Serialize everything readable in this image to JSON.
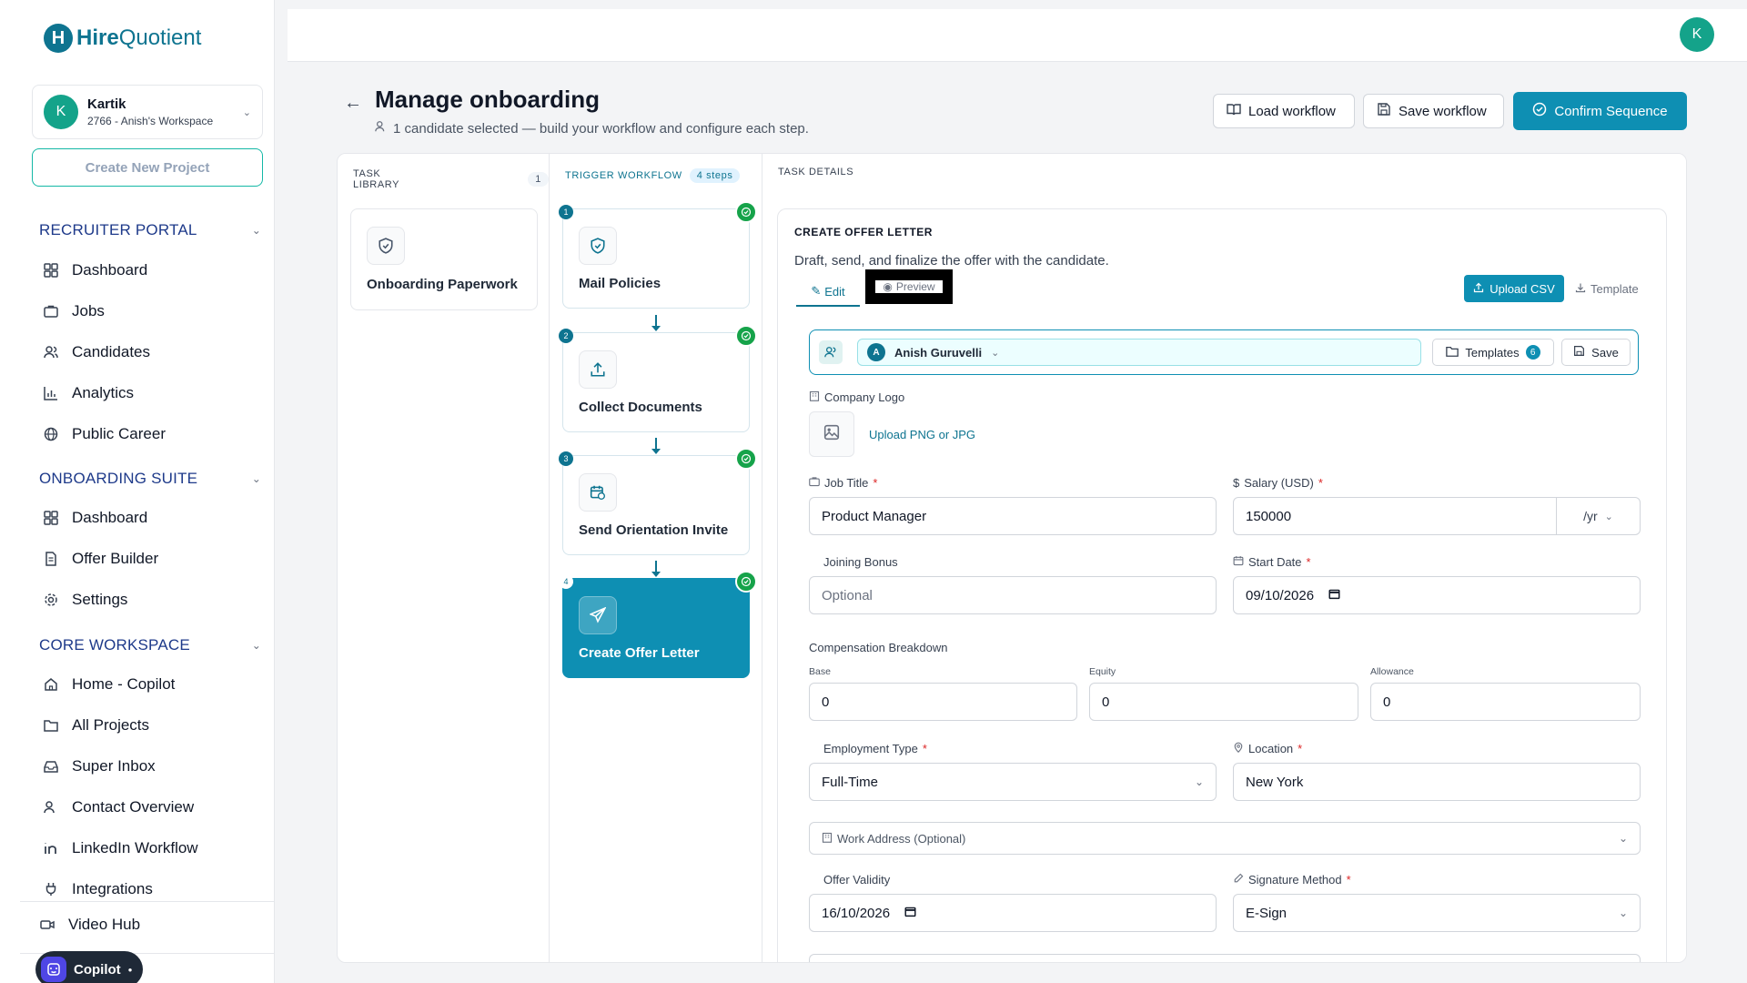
{
  "app": {
    "logo_bold": "Hire",
    "logo_light": "Quotient"
  },
  "workspace": {
    "avatar": "K",
    "user": "Kartik",
    "name": "2766 - Anish's Workspace"
  },
  "sidebar": {
    "create_project": "Create New Project",
    "sections": [
      {
        "title": "RECRUITER PORTAL",
        "items": [
          "Dashboard",
          "Jobs",
          "Candidates",
          "Analytics",
          "Public Career"
        ]
      },
      {
        "title": "ONBOARDING SUITE",
        "items": [
          "Dashboard",
          "Offer Builder",
          "Settings"
        ]
      },
      {
        "title": "CORE WORKSPACE",
        "items": [
          "Home - Copilot",
          "All Projects",
          "Super Inbox",
          "Contact Overview",
          "LinkedIn Workflow",
          "Integrations"
        ]
      }
    ],
    "bottom_item": "Video Hub",
    "copilot": "Copilot"
  },
  "header": {
    "avatar": "K",
    "title": "Manage onboarding",
    "subtitle": "1 candidate selected — build your workflow and configure each step.",
    "load_workflow": "Load workflow",
    "save_workflow": "Save workflow",
    "confirm": "Confirm Sequence"
  },
  "library": {
    "heading": "TASK LIBRARY",
    "count": "1",
    "tasks": [
      "Onboarding Paperwork"
    ]
  },
  "workflow": {
    "heading": "TRIGGER WORKFLOW",
    "steps_badge": "4 steps",
    "steps": [
      {
        "num": "1",
        "label": "Mail Policies"
      },
      {
        "num": "2",
        "label": "Collect Documents"
      },
      {
        "num": "3",
        "label": "Send Orientation Invite"
      },
      {
        "num": "4",
        "label": "Create Offer Letter"
      }
    ]
  },
  "details": {
    "heading": "TASK DETAILS",
    "card_title": "CREATE OFFER LETTER",
    "card_desc": "Draft, send, and finalize the offer with the candidate.",
    "tab_edit": "Edit",
    "tab_preview": "Preview",
    "upload_csv": "Upload CSV",
    "template": "Template",
    "recipient": {
      "avatar": "A",
      "name": "Anish Guruvelli"
    },
    "templates_btn": "Templates",
    "templates_count": "6",
    "save_btn": "Save",
    "company_logo_label": "Company Logo",
    "upload_logo": "Upload PNG or JPG",
    "job_title_label": "Job Title",
    "job_title_value": "Product Manager",
    "salary_label": "Salary (USD)",
    "salary_value": "150000",
    "salary_unit": "/yr",
    "bonus_label": "Joining Bonus",
    "bonus_placeholder": "Optional",
    "start_label": "Start Date",
    "start_value": "09/10/2026",
    "comp_label": "Compensation Breakdown",
    "base_label": "Base",
    "base_value": "0",
    "equity_label": "Equity",
    "equity_value": "0",
    "allowance_label": "Allowance",
    "allowance_value": "0",
    "emp_type_label": "Employment Type",
    "emp_type_value": "Full-Time",
    "location_label": "Location",
    "location_value": "New York",
    "work_address": "Work Address (Optional)",
    "validity_label": "Offer Validity",
    "validity_value": "16/10/2026",
    "signature_label": "Signature Method",
    "signature_value": "E-Sign",
    "required_mark": "*"
  },
  "colors": {
    "brand": "#0e8fb3",
    "brand_dark": "#0e7490",
    "success": "#16a34a",
    "avatar": "#14a38a"
  }
}
